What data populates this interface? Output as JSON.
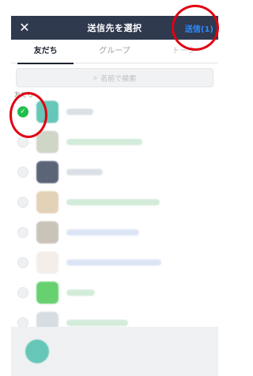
{
  "header": {
    "title": "送信先を選択",
    "send_label": "送信(1)"
  },
  "tabs": [
    {
      "label": "友だち",
      "active": true
    },
    {
      "label": "グループ",
      "active": false
    },
    {
      "label": "トーク",
      "active": false
    }
  ],
  "search": {
    "placeholder": "名前で検索"
  },
  "section": {
    "label": "友だち"
  },
  "rows": [
    {
      "selected": true
    },
    {
      "selected": false
    },
    {
      "selected": false
    },
    {
      "selected": false
    },
    {
      "selected": false
    },
    {
      "selected": false
    },
    {
      "selected": false
    },
    {
      "selected": false
    }
  ],
  "icons": {
    "close": "close-icon",
    "search": "search-icon",
    "check": "checkmark-icon"
  },
  "colors": {
    "header_bg": "#2f3a4f",
    "accent_blue": "#2e8bff",
    "selected_green": "#1fbf4d",
    "annotation_red": "#e00012"
  }
}
